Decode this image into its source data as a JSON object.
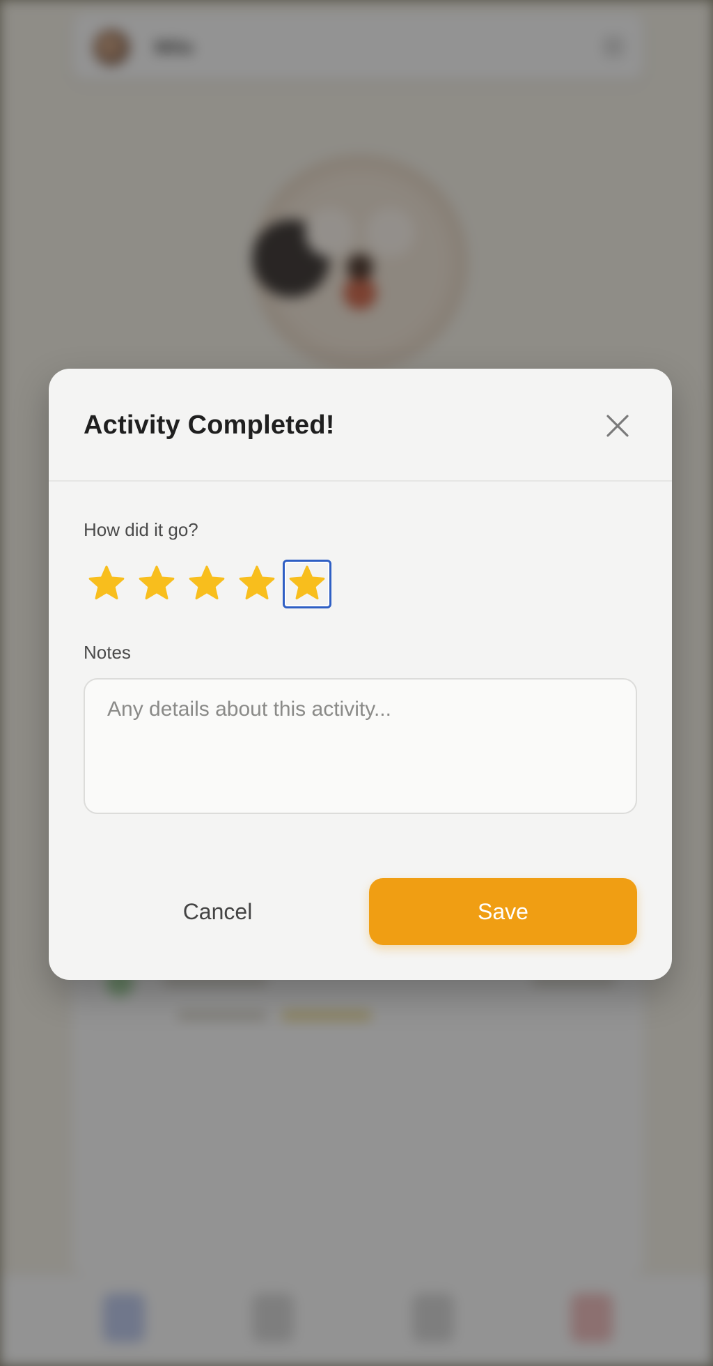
{
  "background": {
    "pet_name": "Milo"
  },
  "modal": {
    "title": "Activity Completed!",
    "close_icon": "close-icon",
    "rating": {
      "label": "How did it go?",
      "value": 5,
      "max": 5,
      "star_color": "#F8BE1D",
      "focused_star": 5
    },
    "notes": {
      "label": "Notes",
      "placeholder": "Any details about this activity...",
      "value": ""
    },
    "cancel_label": "Cancel",
    "save_label": "Save",
    "accent_color": "#F09E13"
  }
}
